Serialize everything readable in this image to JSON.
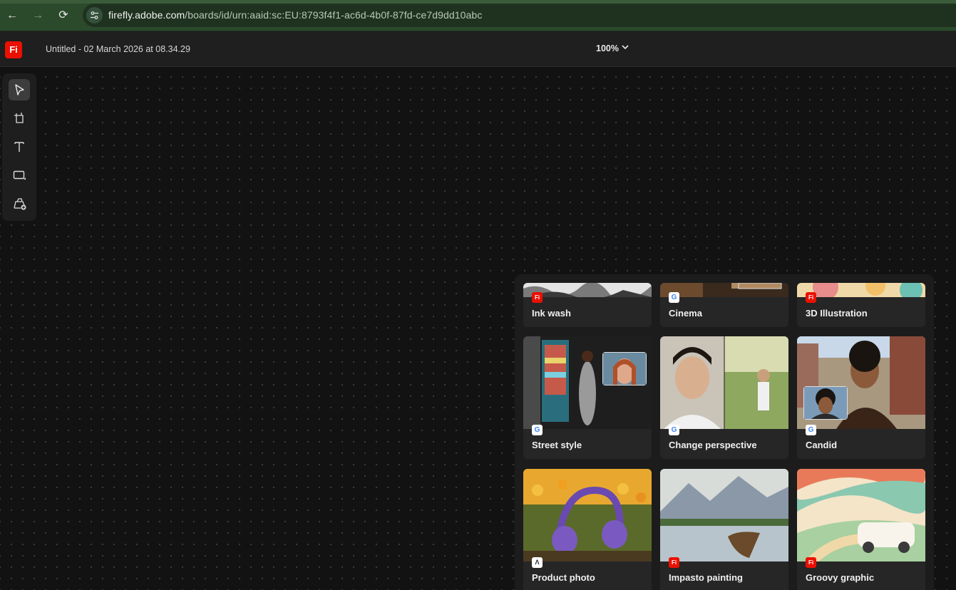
{
  "browser": {
    "back_icon": "←",
    "forward_icon": "→",
    "reload_icon": "⟳",
    "url_host": "firefly.adobe.com",
    "url_path": "/boards/id/urn:aaid:sc:EU:8793f4f1-ac6d-4b0f-87fd-ce7d9dd10abc"
  },
  "header": {
    "logo_text": "Fi",
    "document_title": "Untitled - 02 March 2026 at 08.34.29",
    "zoom_level": "100%"
  },
  "toolbar": {
    "tools": [
      "select-tool",
      "page-tool",
      "text-tool",
      "shape-tool",
      "generate-image-tool"
    ],
    "active": "select-tool"
  },
  "style_panel": {
    "cards": [
      {
        "label": "Ink wash",
        "provider": "Fi"
      },
      {
        "label": "Cinema",
        "provider": "G"
      },
      {
        "label": "3D Illustration",
        "provider": "Fi"
      },
      {
        "label": "Street style",
        "provider": "G"
      },
      {
        "label": "Change perspective",
        "provider": "G"
      },
      {
        "label": "Candid",
        "provider": "G"
      },
      {
        "label": "Product photo",
        "provider": "Λ"
      },
      {
        "label": "Impasto painting",
        "provider": "Fi"
      },
      {
        "label": "Groovy graphic",
        "provider": "Fi"
      }
    ]
  },
  "colors": {
    "brand_red": "#eb1000",
    "browser_green": "#2b4a2b",
    "canvas_bg": "#121212",
    "panel_bg": "#1c1c1c"
  }
}
